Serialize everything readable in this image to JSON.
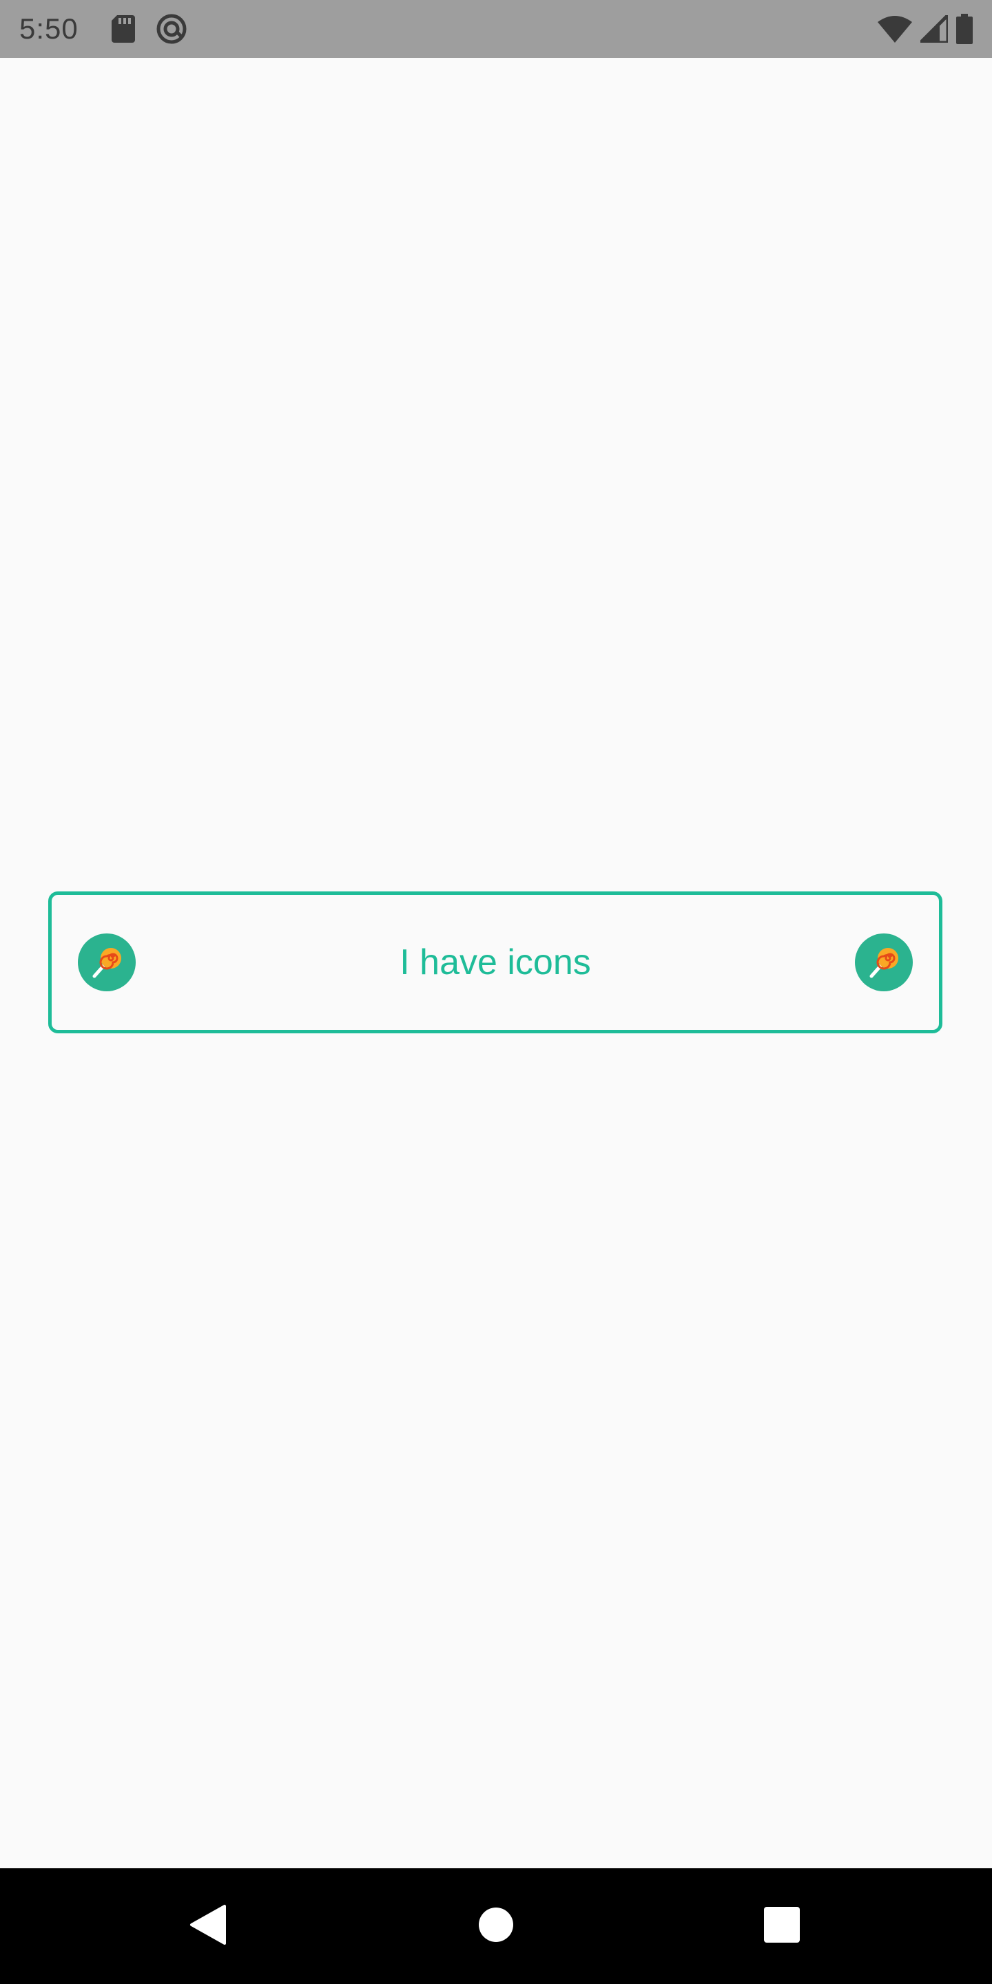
{
  "status_bar": {
    "time": "5:50",
    "icons": [
      "sd-card-icon",
      "sync-icon",
      "wifi-icon",
      "signal-icon",
      "battery-icon"
    ]
  },
  "main": {
    "button": {
      "label": "I have icons",
      "leading_icon": "lollipop-icon",
      "trailing_icon": "lollipop-icon",
      "accent_color": "#1ebc98"
    }
  },
  "nav_bar": {
    "buttons": [
      "back-icon",
      "home-icon",
      "recents-icon"
    ]
  }
}
